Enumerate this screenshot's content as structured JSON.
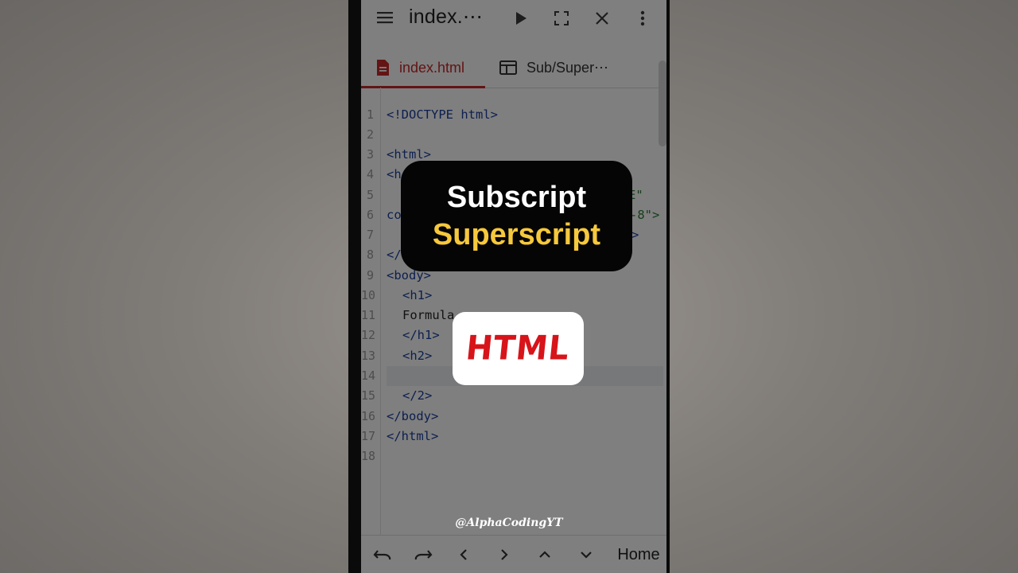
{
  "toolbar": {
    "title": "index.⋯",
    "menu_icon": "menu-icon",
    "run_icon": "play-icon",
    "fullscreen_icon": "fullscreen-icon",
    "close_icon": "close-icon",
    "more_icon": "more-vertical-icon"
  },
  "tabs": [
    {
      "label": "index.html",
      "icon": "file-icon",
      "active": true
    },
    {
      "label": "Sub/Super⋯",
      "icon": "browser-window-icon",
      "active": false
    }
  ],
  "editor": {
    "line_numbers": [
      "1",
      "2",
      "3",
      "4",
      "5",
      "6",
      "7",
      "8",
      "9",
      "10",
      "11",
      "12",
      "13",
      "14",
      "15",
      "16",
      "17",
      "18"
    ],
    "lines": [
      "<!DOCTYPE html>",
      "",
      "<html>",
      "<h",
      "E\"",
      "-8\">",
      ">",
      "</",
      "<body>",
      "<h1>",
      "Formula",
      "</h1>",
      "<h2>",
      "",
      "</2>",
      "</body>",
      "</html>",
      "",
      "co"
    ]
  },
  "bottom_bar": {
    "undo_icon": "undo-icon",
    "redo_icon": "redo-icon",
    "left_icon": "chevron-left-icon",
    "right_icon": "chevron-right-icon",
    "up_icon": "chevron-up-icon",
    "down_icon": "chevron-down-icon",
    "home_label": "Home"
  },
  "overlay": {
    "title_line1": "Subscript",
    "title_line2": "Superscript",
    "html_badge": "HTML",
    "watermark": "@AlphaCodingYT"
  },
  "colors": {
    "accent_red": "#c62828",
    "overlay_yellow": "#f6c83c",
    "html_red": "#d7141a",
    "keyword_blue": "#1a3f9e",
    "string_green": "#2e7d32"
  }
}
